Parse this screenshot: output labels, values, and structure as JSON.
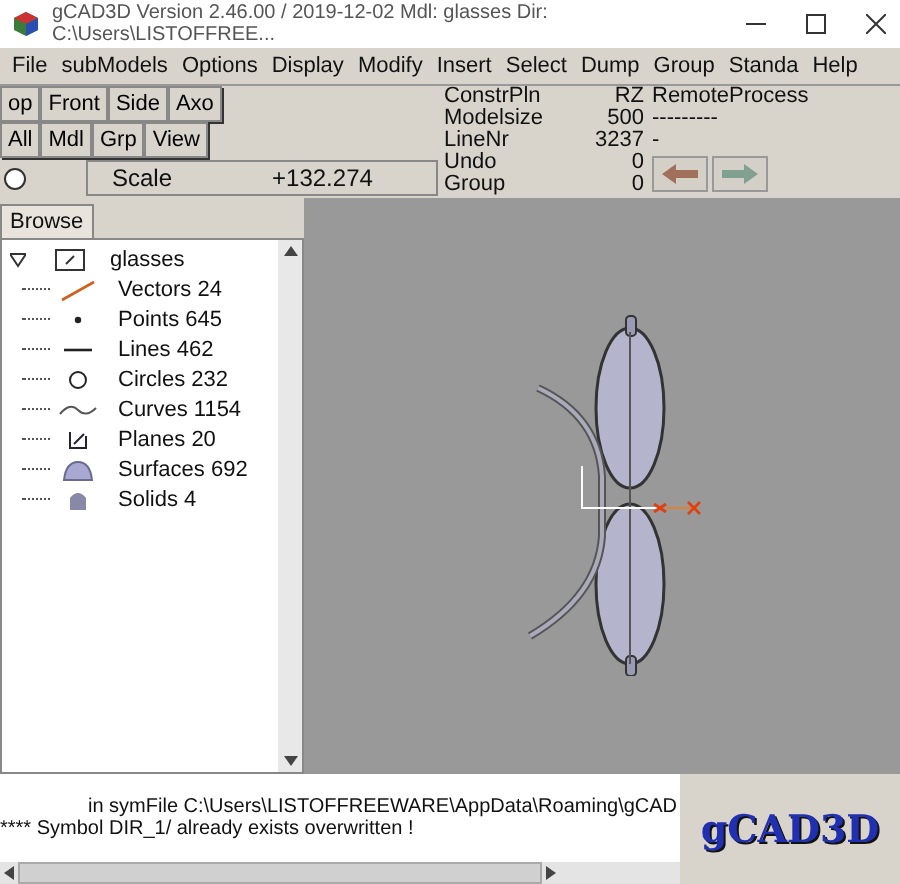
{
  "window": {
    "title": "gCAD3D Version 2.46.00 / 2019-12-02   Mdl: glasses   Dir: C:\\Users\\LISTOFFREE..."
  },
  "menu": [
    "File",
    "subModels",
    "Options",
    "Display",
    "Modify",
    "Insert",
    "Select",
    "Dump",
    "Group",
    "Standa",
    "Help"
  ],
  "view_buttons": [
    [
      "op",
      "Front",
      "Side",
      "Axo"
    ],
    [
      "All",
      "Mdl",
      "Grp",
      "View"
    ]
  ],
  "scale": {
    "label": "Scale",
    "value": "+132.274",
    "selected": false
  },
  "info": [
    {
      "label": "ConstrPln",
      "value": "RZ",
      "extra": "RemoteProcess"
    },
    {
      "label": "Modelsize",
      "value": "500",
      "extra": "---------"
    },
    {
      "label": "LineNr",
      "value": "3237",
      "extra": "-"
    },
    {
      "label": "Undo",
      "value": "0"
    },
    {
      "label": "Group",
      "value": "0"
    }
  ],
  "tabs": [
    {
      "label": "Browse",
      "selected": true
    }
  ],
  "tree": [
    {
      "label": "glasses",
      "kind": "model",
      "expanded": true,
      "children": [
        {
          "label": "Vectors 24",
          "kind": "vector"
        },
        {
          "label": "Points 645",
          "kind": "point"
        },
        {
          "label": "Lines 462",
          "kind": "line"
        },
        {
          "label": "Circles 232",
          "kind": "circle"
        },
        {
          "label": "Curves 1154",
          "kind": "curve"
        },
        {
          "label": "Planes 20",
          "kind": "plane"
        },
        {
          "label": "Surfaces 692",
          "kind": "surface"
        },
        {
          "label": "Solids 4",
          "kind": "solid"
        }
      ]
    }
  ],
  "messages": [
    "in symFile C:\\Users\\LISTOFFREEWARE\\AppData\\Roaming\\gCAD",
    "**** Symbol DIR_1/ already exists  overwritten !"
  ],
  "logo": "gCAD3D"
}
